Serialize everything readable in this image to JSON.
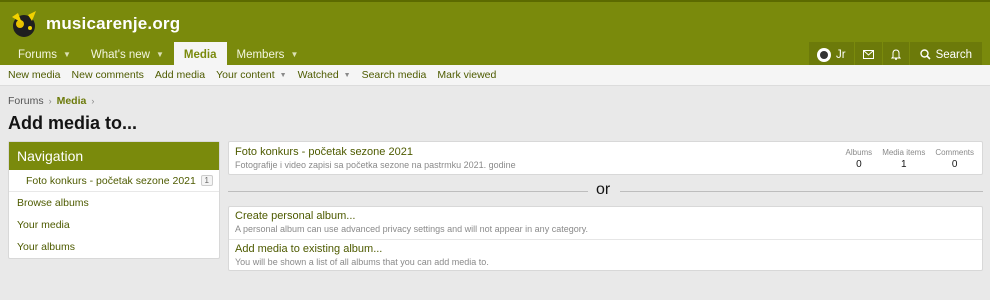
{
  "site": {
    "logo_text": "musicarenje.org"
  },
  "nav": {
    "tabs": [
      {
        "label": "Forums"
      },
      {
        "label": "What's new"
      },
      {
        "label": "Media"
      },
      {
        "label": "Members"
      }
    ],
    "user": "Jr",
    "search_label": "Search"
  },
  "subnav": {
    "items": [
      {
        "label": "New media"
      },
      {
        "label": "New comments"
      },
      {
        "label": "Add media"
      },
      {
        "label": "Your content"
      },
      {
        "label": "Watched"
      },
      {
        "label": "Search media"
      },
      {
        "label": "Mark viewed"
      }
    ]
  },
  "breadcrumb": {
    "items": [
      "Forums",
      "Media"
    ]
  },
  "page_title": "Add media to...",
  "sidebar": {
    "title": "Navigation",
    "category": {
      "label": "Foto konkurs - početak sezone 2021",
      "count": "1"
    },
    "links": [
      "Browse albums",
      "Your media",
      "Your albums"
    ]
  },
  "category_card": {
    "title": "Foto konkurs - početak sezone 2021",
    "description": "Fotografije i video zapisi sa početka sezone na pastrmku 2021. godine",
    "stats": [
      {
        "label": "Albums",
        "value": "0"
      },
      {
        "label": "Media items",
        "value": "1"
      },
      {
        "label": "Comments",
        "value": "0"
      }
    ]
  },
  "or_label": "or",
  "actions": [
    {
      "title": "Create personal album...",
      "description": "A personal album can use advanced privacy settings and will not appear in any category."
    },
    {
      "title": "Add media to existing album...",
      "description": "You will be shown a list of all albums that you can add media to."
    }
  ],
  "colors": {
    "brand": "#7a8a0c",
    "link": "#4e5b00"
  }
}
